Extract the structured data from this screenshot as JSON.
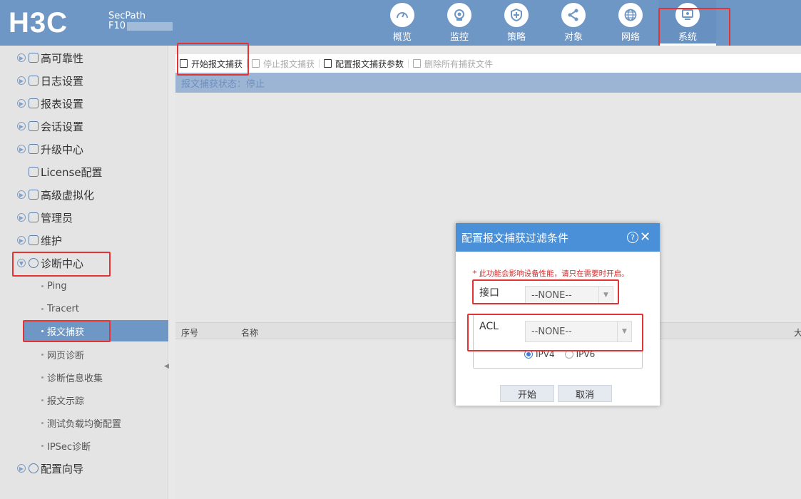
{
  "header": {
    "logo": "H3C",
    "product_line1": "SecPath",
    "product_line2": "F10",
    "nav": [
      {
        "label": "概览",
        "icon": "gauge-icon"
      },
      {
        "label": "监控",
        "icon": "eye-icon"
      },
      {
        "label": "策略",
        "icon": "shield-icon"
      },
      {
        "label": "对象",
        "icon": "share-icon"
      },
      {
        "label": "网络",
        "icon": "globe-icon"
      },
      {
        "label": "系统",
        "icon": "monitor-icon",
        "active": true
      }
    ]
  },
  "sidebar": {
    "items": [
      {
        "label": "高可靠性"
      },
      {
        "label": "日志设置"
      },
      {
        "label": "报表设置"
      },
      {
        "label": "会话设置"
      },
      {
        "label": "升级中心"
      },
      {
        "label": "License配置"
      },
      {
        "label": "高级虚拟化"
      },
      {
        "label": "管理员"
      },
      {
        "label": "维护"
      },
      {
        "label": "诊断中心",
        "expanded": true
      },
      {
        "label": "配置向导"
      }
    ],
    "sub_items": [
      {
        "label": "Ping"
      },
      {
        "label": "Tracert"
      },
      {
        "label": "报文捕获",
        "active": true
      },
      {
        "label": "网页诊断"
      },
      {
        "label": "诊断信息收集"
      },
      {
        "label": "报文示踪"
      },
      {
        "label": "测试负载均衡配置"
      },
      {
        "label": "IPSec诊断"
      }
    ]
  },
  "toolbar": {
    "start": "开始报文捕获",
    "stop": "停止报文捕获",
    "config": "配置报文捕获参数",
    "delete_all": "删除所有捕获文件"
  },
  "status": "报文捕获状态：停止",
  "table": {
    "col_index": "序号",
    "col_name": "名称",
    "col_size": "大"
  },
  "dialog": {
    "title": "配置报文捕获过滤条件",
    "help": "?",
    "warning": "* 此功能会影响设备性能，请只在需要时开启。",
    "interface_label": "接口",
    "interface_value": "--NONE--",
    "acl_label": "ACL",
    "acl_value": "--NONE--",
    "ipv4": "IPV4",
    "ipv6": "IPV6",
    "ip_selected": "IPV4",
    "start_btn": "开始",
    "cancel_btn": "取消"
  },
  "colors": {
    "header_bg": "#6f97c5",
    "highlight": "#e53333",
    "dialog_header": "#4a90d9",
    "warning": "#d42b2b"
  }
}
